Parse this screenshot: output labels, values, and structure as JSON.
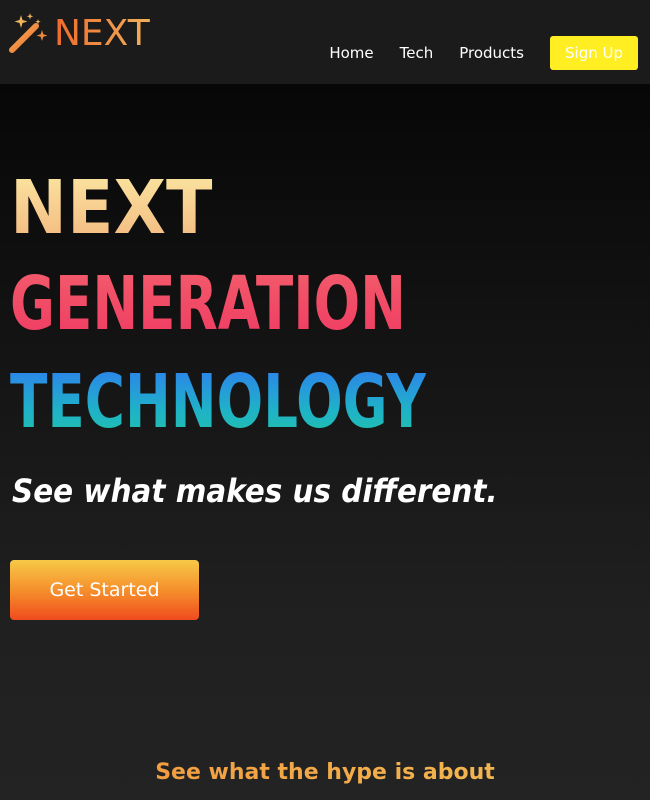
{
  "brand": {
    "logo_text": "NEXT",
    "icon": "magic-wand-icon"
  },
  "nav": {
    "items": [
      {
        "label": "Home"
      },
      {
        "label": "Tech"
      },
      {
        "label": "Products"
      }
    ],
    "signup_label": "Sign Up"
  },
  "hero": {
    "headline": [
      "NEXT",
      "GENERATION",
      "TECHNOLOGY"
    ],
    "tagline": "See what makes us different.",
    "cta_label": "Get Started"
  },
  "section": {
    "heading": "See what the hype is about"
  },
  "colors": {
    "navbar_bg": "#1b1b1b",
    "signup_bg": "#ffee22",
    "headline_line1": "#f7d08f",
    "headline_line2": "#f04866",
    "headline_line3": "#1fa6d6",
    "cta_gradient_top": "#f7c948",
    "cta_gradient_bottom": "#f04a1e",
    "accent_orange": "#f0933a"
  }
}
